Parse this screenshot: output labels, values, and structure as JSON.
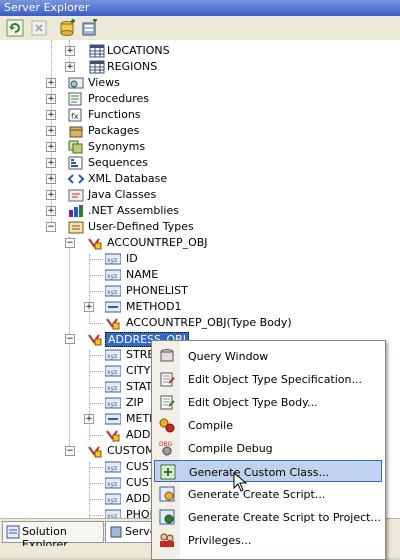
{
  "window": {
    "title": "Server Explorer"
  },
  "toolbar": {
    "icons": [
      "refresh-icon",
      "stop-icon",
      "connect-database-icon",
      "connect-server-icon"
    ]
  },
  "tree": {
    "items": [
      {
        "label": "LOCATIONS"
      },
      {
        "label": "REGIONS"
      },
      {
        "label": "Views"
      },
      {
        "label": "Procedures"
      },
      {
        "label": "Functions"
      },
      {
        "label": "Packages"
      },
      {
        "label": "Synonyms"
      },
      {
        "label": "Sequences"
      },
      {
        "label": "XML Database"
      },
      {
        "label": "Java Classes"
      },
      {
        "label": ".NET Assemblies"
      },
      {
        "label": "User-Defined Types"
      },
      {
        "label": "ACCOUNTREP_OBJ"
      },
      {
        "label": "ID"
      },
      {
        "label": "NAME"
      },
      {
        "label": "PHONELIST"
      },
      {
        "label": "METHOD1"
      },
      {
        "label": "ACCOUNTREP_OBJ(Type Body)"
      },
      {
        "label": "ADDRESS_OBJ"
      },
      {
        "label": "STRE"
      },
      {
        "label": "CITY"
      },
      {
        "label": "STAT"
      },
      {
        "label": "ZIP"
      },
      {
        "label": "METH"
      },
      {
        "label": "ADDR"
      },
      {
        "label": "CUSTOM"
      },
      {
        "label": "CUST"
      },
      {
        "label": "CUST"
      },
      {
        "label": "ADDR"
      },
      {
        "label": "PHON"
      }
    ]
  },
  "context_menu": {
    "items": [
      {
        "label": "Query Window"
      },
      {
        "label": "Edit Object Type Specification..."
      },
      {
        "label": "Edit Object Type Body..."
      },
      {
        "label": "Compile"
      },
      {
        "label": "Compile Debug"
      },
      {
        "label": "Generate Custom Class..."
      },
      {
        "label": "Generate Create Script..."
      },
      {
        "label": "Generate Create Script to Project..."
      },
      {
        "label": "Privileges..."
      }
    ],
    "highlighted": "Generate Custom Class..."
  },
  "bottom_tabs": [
    {
      "label": "Solution Explorer"
    },
    {
      "label": "Serve"
    }
  ],
  "colors": {
    "selection": "#316ac5",
    "menu_highlight": "#c1d2ee",
    "title_bar": "#3a5bc7"
  }
}
